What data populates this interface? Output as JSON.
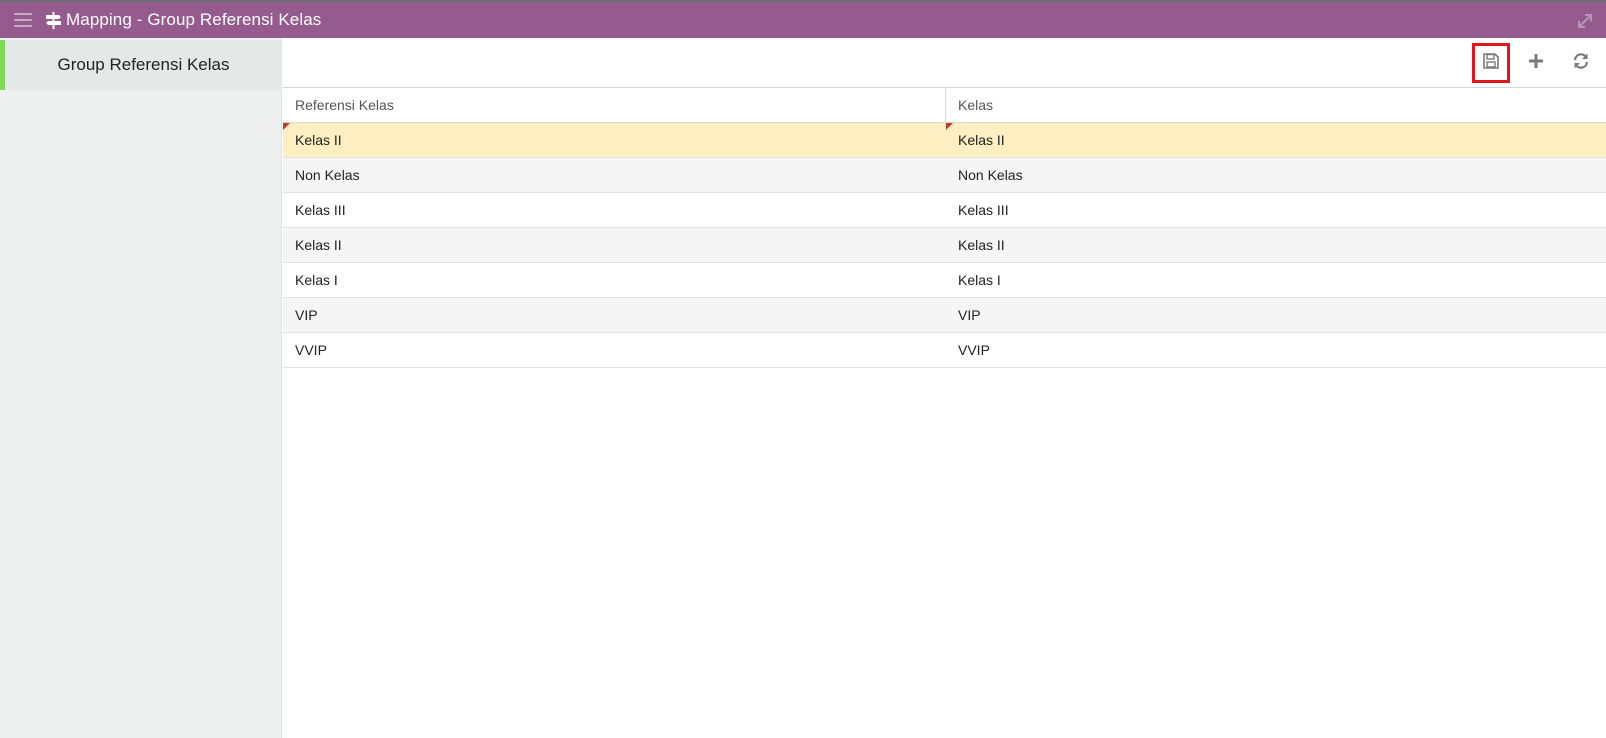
{
  "window": {
    "title": "Mapping - Group Referensi Kelas",
    "menu_icon": "hamburger-menu-icon",
    "title_icon": "signpost-icon",
    "expand_icon": "expand-arrows-icon",
    "accent_color": "#955b8e"
  },
  "sidebar": {
    "items": [
      {
        "label": "Group Referensi Kelas",
        "active": true
      }
    ]
  },
  "toolbar": {
    "buttons": [
      {
        "icon": "save-icon",
        "highlighted": true
      },
      {
        "icon": "plus-icon"
      },
      {
        "icon": "refresh-icon"
      }
    ]
  },
  "grid": {
    "columns": [
      "Referensi Kelas",
      "Kelas"
    ],
    "rows": [
      {
        "referensi_kelas": "Kelas II",
        "kelas": "Kelas II",
        "selected": true,
        "modified": true
      },
      {
        "referensi_kelas": "Non Kelas",
        "kelas": "Non Kelas"
      },
      {
        "referensi_kelas": "Kelas III",
        "kelas": "Kelas III"
      },
      {
        "referensi_kelas": "Kelas II",
        "kelas": "Kelas II"
      },
      {
        "referensi_kelas": "Kelas I",
        "kelas": "Kelas I"
      },
      {
        "referensi_kelas": "VIP",
        "kelas": "VIP"
      },
      {
        "referensi_kelas": "VVIP",
        "kelas": "VVIP"
      }
    ]
  }
}
